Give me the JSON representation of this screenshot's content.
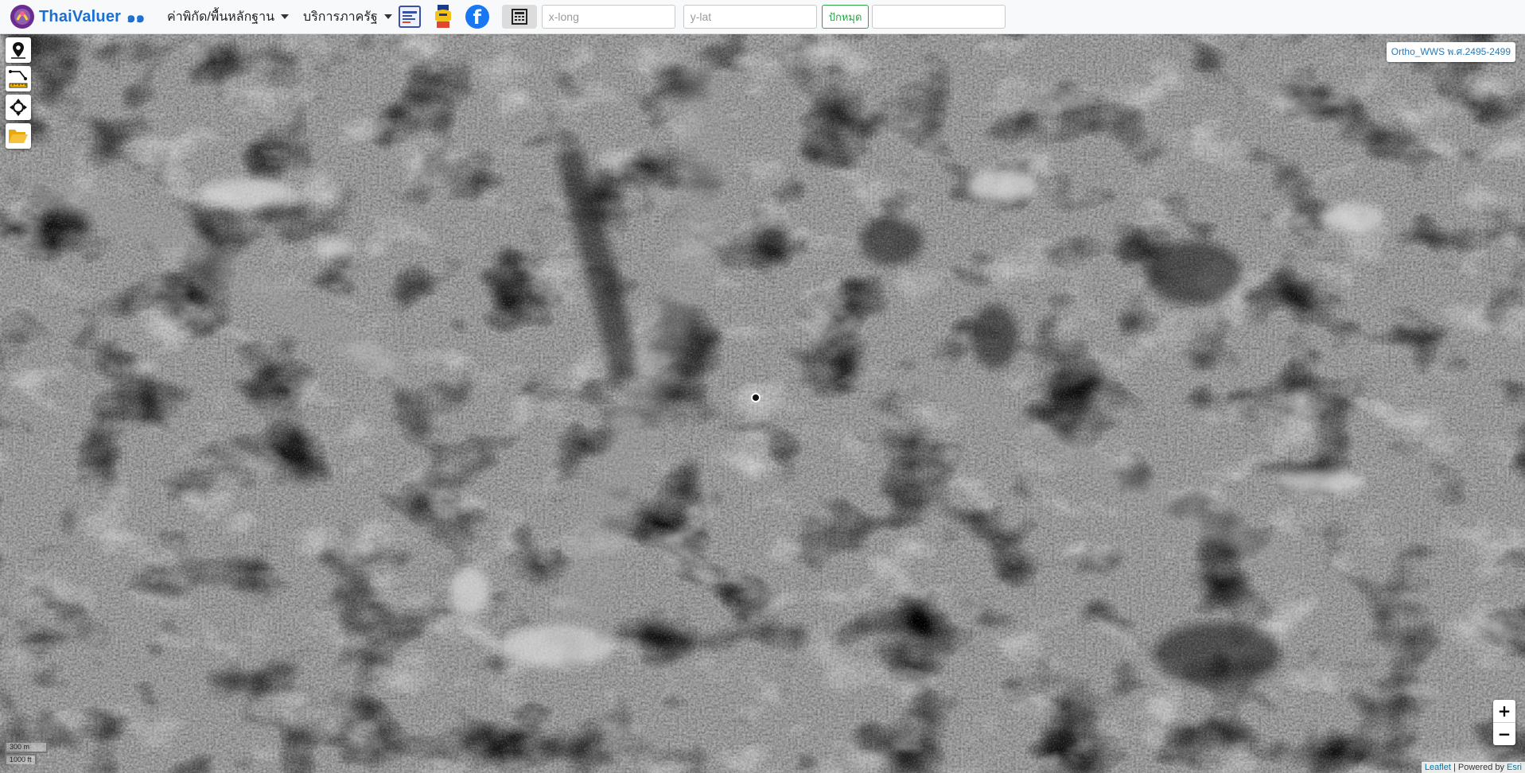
{
  "navbar": {
    "brand": "ThaiValuer",
    "brand_suffix": "๑๑",
    "menus": [
      {
        "label": "ค่าพิกัด/พื้นหลักฐาน"
      },
      {
        "label": "บริการภาครัฐ"
      }
    ],
    "icons": [
      "land-registry-icon",
      "sign-up-icon",
      "facebook-icon",
      "calculator-icon"
    ],
    "x_input": {
      "placeholder": "x-long",
      "value": ""
    },
    "y_input": {
      "placeholder": "y-lat",
      "value": ""
    },
    "pin_label": "ปักหมุด",
    "extra_input": {
      "value": ""
    }
  },
  "map": {
    "layer_label": "Ortho_WWS พ.ศ.2495-2499",
    "basemap": "grayscale aerial orthophoto",
    "tools": [
      "add-marker-icon",
      "measure-icon",
      "locate-icon",
      "open-folder-icon"
    ],
    "zoom": {
      "in": "+",
      "out": "−"
    },
    "scale": {
      "metric": "300 m",
      "imperial": "1000 ft"
    },
    "attribution": {
      "leaflet": "Leaflet",
      "separator": " | Powered by ",
      "provider": "Esri"
    }
  },
  "colors": {
    "brand": "#1a6fd1",
    "pin": "#28a745",
    "facebook": "#1877f2",
    "link": "#0078a8"
  }
}
